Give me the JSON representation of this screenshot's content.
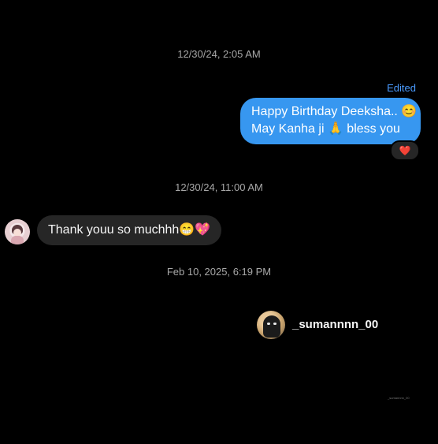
{
  "timestamps": [
    "12/30/24, 2:05 AM",
    "12/30/24, 11:00 AM",
    "Feb 10, 2025, 6:19 PM"
  ],
  "outgoing": {
    "edited_label": "Edited",
    "line1": "Happy Birthday Deeksha.. 😊",
    "line2": "May Kanha ji 🙏 bless you",
    "reaction": "❤️"
  },
  "incoming": {
    "text": "Thank youu so muchhh😁💖"
  },
  "shared_profile": {
    "username": "_sumannnn_00",
    "tiny_label": "_sumannnn_00"
  },
  "colors": {
    "background": "#000000",
    "outgoing_bubble": "#3797f0",
    "incoming_bubble": "#262626",
    "timestamp": "#a8a8a8",
    "edited": "#4a9bff"
  }
}
